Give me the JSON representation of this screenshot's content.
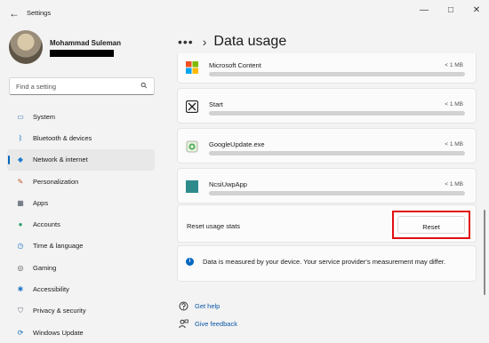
{
  "window": {
    "title": "Settings",
    "back_glyph": "←",
    "minimize_glyph": "—",
    "maximize_glyph": "□",
    "close_glyph": "✕"
  },
  "user": {
    "name": "Mohammad Suleman"
  },
  "search": {
    "placeholder": "Find a setting",
    "icon": "search-icon"
  },
  "sidebar": {
    "items": [
      {
        "label": "System",
        "icon": "system-icon",
        "glyph": "▭",
        "color": "#2b6cb8",
        "active": false
      },
      {
        "label": "Bluetooth & devices",
        "icon": "bluetooth-icon",
        "glyph": "ᛒ",
        "color": "#0f6cbd",
        "active": false
      },
      {
        "label": "Network & internet",
        "icon": "wifi-icon",
        "glyph": "◆",
        "color": "#1e7dd3",
        "active": true
      },
      {
        "label": "Personalization",
        "icon": "brush-icon",
        "glyph": "✎",
        "color": "#c2572a",
        "active": false
      },
      {
        "label": "Apps",
        "icon": "apps-icon",
        "glyph": "▦",
        "color": "#4b5563",
        "active": false
      },
      {
        "label": "Accounts",
        "icon": "person-icon",
        "glyph": "●",
        "color": "#2a9d6a",
        "active": false
      },
      {
        "label": "Time & language",
        "icon": "globe-clock-icon",
        "glyph": "◷",
        "color": "#2176c9",
        "active": false
      },
      {
        "label": "Gaming",
        "icon": "controller-icon",
        "glyph": "◎",
        "color": "#555555",
        "active": false
      },
      {
        "label": "Accessibility",
        "icon": "accessibility-icon",
        "glyph": "✱",
        "color": "#2374c9",
        "active": false
      },
      {
        "label": "Privacy & security",
        "icon": "shield-icon",
        "glyph": "⛉",
        "color": "#6b7280",
        "active": false
      },
      {
        "label": "Windows Update",
        "icon": "update-icon",
        "glyph": "⟳",
        "color": "#0f6cbd",
        "active": false
      }
    ]
  },
  "header": {
    "dots": "•••",
    "chevron": "›",
    "title": "Data usage"
  },
  "apps": [
    {
      "name": "Microsoft Content",
      "size": "< 1 MB",
      "icon": "microsoft-logo-icon"
    },
    {
      "name": "Start",
      "size": "< 1 MB",
      "icon": "start-app-icon"
    },
    {
      "name": "GoogleUpdate.exe",
      "size": "< 1 MB",
      "icon": "google-update-icon"
    },
    {
      "name": "NcsiUwpApp",
      "size": "< 1 MB",
      "icon": "ncsi-app-icon"
    }
  ],
  "reset": {
    "label": "Reset usage stats",
    "button_label": "Reset"
  },
  "info": {
    "glyph": "i",
    "text": "Data is measured by your device. Your service provider's measurement may differ."
  },
  "links": {
    "help": "Get help",
    "feedback": "Give feedback"
  },
  "colors": {
    "accent": "#0067c0",
    "highlight": "#e01010"
  }
}
